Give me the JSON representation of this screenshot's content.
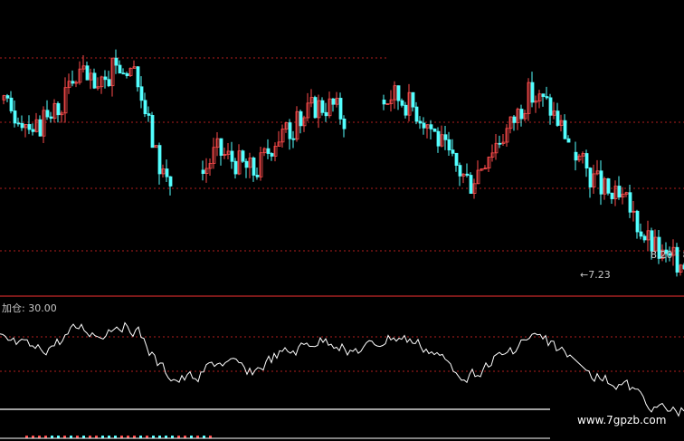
{
  "colors": {
    "up": "#ff4c4c",
    "down": "#53ffff",
    "grid": "#b01e1e",
    "separator": "#c62828",
    "indicator_line": "#ffffff",
    "text": "#c8c8c8",
    "background": "#000000"
  },
  "annotations": {
    "indicator_label": "加仓: 30.00",
    "low_price": "←7.23",
    "range": "8.20 - 8",
    "watermark": "www.7gpzb.com"
  },
  "chart_data": [
    {
      "type": "candlestick",
      "description": "daily K-line",
      "annotations": [
        "←7.23",
        "8.20 - 8"
      ],
      "grid": true,
      "trend_y_values_relative": [
        7.95,
        7.9,
        7.85,
        7.95,
        8.1,
        8.0,
        8.15,
        8.05,
        7.7,
        7.55,
        7.6,
        7.75,
        7.7,
        7.65,
        7.8,
        7.85,
        7.95,
        7.95,
        7.85,
        7.9,
        8.0,
        7.95,
        7.85,
        7.7,
        7.6,
        7.75,
        7.85,
        8.0,
        7.95,
        7.8,
        7.65,
        7.55,
        7.5,
        7.35,
        7.25,
        7.25
      ]
    },
    {
      "type": "line",
      "series": [
        {
          "name": "加仓",
          "last_value": 30.0
        }
      ],
      "reference_line": 30.0
    }
  ]
}
